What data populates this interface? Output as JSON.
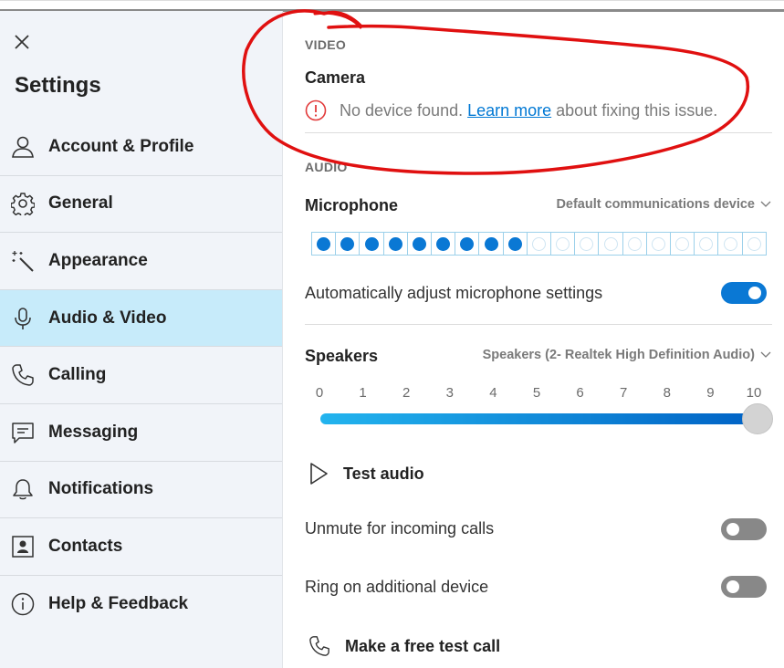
{
  "sidebar": {
    "title": "Settings",
    "items": [
      {
        "label": "Account & Profile",
        "icon": "person-icon",
        "active": false
      },
      {
        "label": "General",
        "icon": "gear-icon",
        "active": false
      },
      {
        "label": "Appearance",
        "icon": "magic-wand-icon",
        "active": false
      },
      {
        "label": "Audio & Video",
        "icon": "microphone-icon",
        "active": true
      },
      {
        "label": "Calling",
        "icon": "phone-icon",
        "active": false
      },
      {
        "label": "Messaging",
        "icon": "message-icon",
        "active": false
      },
      {
        "label": "Notifications",
        "icon": "bell-icon",
        "active": false
      },
      {
        "label": "Contacts",
        "icon": "contact-card-icon",
        "active": false
      },
      {
        "label": "Help & Feedback",
        "icon": "info-icon",
        "active": false
      }
    ]
  },
  "video": {
    "section_label": "VIDEO",
    "camera_title": "Camera",
    "error_prefix": "No device found.",
    "error_link": "Learn more",
    "error_suffix": "about fixing this issue."
  },
  "audio": {
    "section_label": "AUDIO",
    "microphone_title": "Microphone",
    "microphone_device": "Default communications device",
    "mic_level_active": 9,
    "mic_level_total": 19,
    "auto_adjust_label": "Automatically adjust microphone settings",
    "auto_adjust_on": true,
    "speakers_title": "Speakers",
    "speakers_device": "Speakers (2- Realtek High Definition Audio)",
    "volume_ticks": [
      "0",
      "1",
      "2",
      "3",
      "4",
      "5",
      "6",
      "7",
      "8",
      "9",
      "10"
    ],
    "volume_value": 10,
    "test_audio_label": "Test audio",
    "unmute_label": "Unmute for incoming calls",
    "unmute_on": false,
    "ring_label": "Ring on additional device",
    "ring_on": false,
    "test_call_label": "Make a free test call"
  },
  "colors": {
    "accent": "#0a78d4",
    "active_nav": "#c7ebfa",
    "annotation": "#e01010"
  }
}
